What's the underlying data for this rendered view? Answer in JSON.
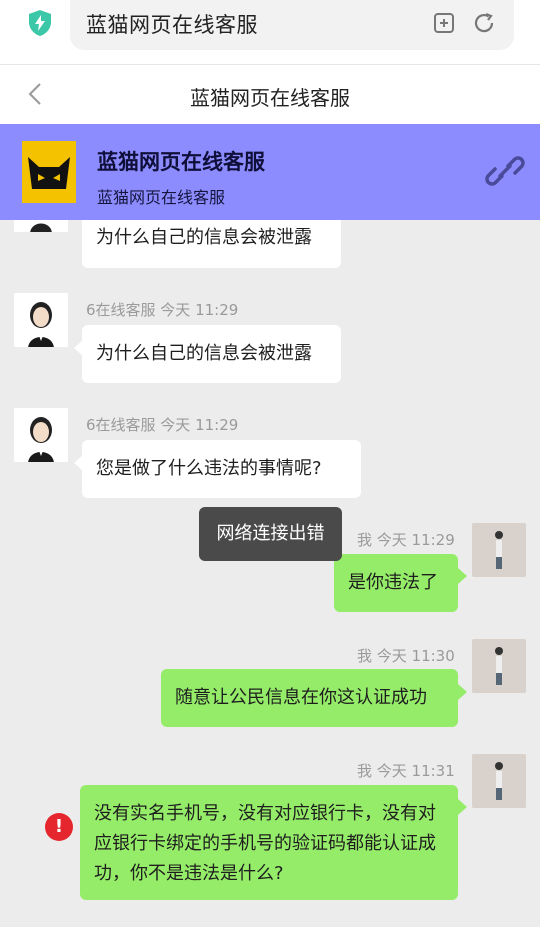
{
  "browser": {
    "url_text": "蓝猫网页在线客服"
  },
  "nav": {
    "title": "蓝猫网页在线客服"
  },
  "chat_header": {
    "title": "蓝猫网页在线客服",
    "subtitle": "蓝猫网页在线客服"
  },
  "messages": [
    {
      "side": "left",
      "meta": "",
      "text": "为什么自己的信息会被泄露"
    },
    {
      "side": "left",
      "meta": "6在线客服 今天 11:29",
      "text": "为什么自己的信息会被泄露"
    },
    {
      "side": "left",
      "meta": "6在线客服 今天 11:29",
      "text": "您是做了什么违法的事情呢?"
    },
    {
      "side": "right",
      "meta": "我 今天 11:29",
      "text": "是你违法了"
    },
    {
      "side": "right",
      "meta": "我 今天 11:30",
      "text": "随意让公民信息在你这认证成功"
    },
    {
      "side": "right",
      "meta": "我 今天 11:31",
      "text": "没有实名手机号，没有对应银行卡，没有对应银行卡绑定的手机号的验证码都能认证成功，你不是违法是什么?"
    }
  ],
  "toast": {
    "text": "网络连接出错"
  },
  "icons": {
    "shield": "shield-bolt-icon",
    "bookmark": "add-bookmark-icon",
    "refresh": "refresh-icon",
    "back": "chevron-left-icon",
    "link": "link-icon",
    "error": "error-icon"
  },
  "colors": {
    "header_bg": "#8c8cff",
    "bubble_self": "#95ec69",
    "bubble_other": "#ffffff",
    "chat_bg": "#ececec",
    "error": "#e6262e"
  }
}
